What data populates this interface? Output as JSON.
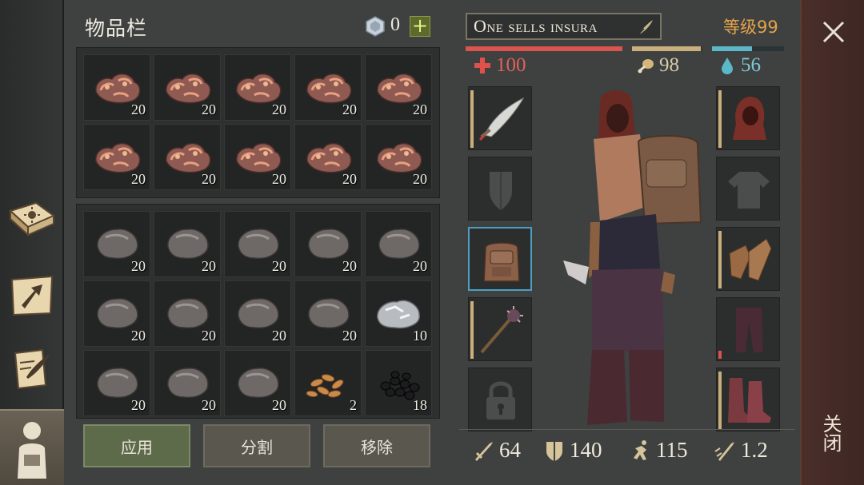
{
  "inventory": {
    "title": "物品栏",
    "currency_count": "0",
    "add_label": "+",
    "top_grid": [
      {
        "item": "copper-ore",
        "qty": "20"
      },
      {
        "item": "copper-ore",
        "qty": "20"
      },
      {
        "item": "copper-ore",
        "qty": "20"
      },
      {
        "item": "copper-ore",
        "qty": "20"
      },
      {
        "item": "copper-ore",
        "qty": "20"
      },
      {
        "item": "copper-ore",
        "qty": "20"
      },
      {
        "item": "copper-ore",
        "qty": "20"
      },
      {
        "item": "copper-ore",
        "qty": "20"
      },
      {
        "item": "copper-ore",
        "qty": "20"
      },
      {
        "item": "copper-ore",
        "qty": "20"
      }
    ],
    "bottom_grid": [
      {
        "item": "stone",
        "qty": "20"
      },
      {
        "item": "stone",
        "qty": "20"
      },
      {
        "item": "stone",
        "qty": "20"
      },
      {
        "item": "stone",
        "qty": "20"
      },
      {
        "item": "stone",
        "qty": "20"
      },
      {
        "item": "stone",
        "qty": "20"
      },
      {
        "item": "stone",
        "qty": "20"
      },
      {
        "item": "stone",
        "qty": "20"
      },
      {
        "item": "stone",
        "qty": "20"
      },
      {
        "item": "iron-ore",
        "qty": "10"
      },
      {
        "item": "stone",
        "qty": "20"
      },
      {
        "item": "stone",
        "qty": "20"
      },
      {
        "item": "stone",
        "qty": "20"
      },
      {
        "item": "seeds",
        "qty": "2"
      },
      {
        "item": "coal",
        "qty": "18"
      }
    ],
    "buttons": {
      "apply": "应用",
      "split": "分割",
      "remove": "移除"
    }
  },
  "character": {
    "name": "One sells insura",
    "level": "等级99",
    "health": {
      "value": "100",
      "fraction": 1.0,
      "color": "#d9534f"
    },
    "hunger": {
      "value": "98",
      "fraction": 0.98,
      "color": "#c9ae7e"
    },
    "thirst": {
      "value": "56",
      "fraction": 0.56,
      "color": "#5bb8c8"
    },
    "equipment_left": [
      {
        "slot": "weapon",
        "item": "scimitar-icon",
        "durability": 1.0
      },
      {
        "slot": "shield",
        "item": "shield-placeholder-icon",
        "durability": 0
      },
      {
        "slot": "backpack",
        "item": "backpack-icon",
        "durability": 0,
        "selected": true
      },
      {
        "slot": "offhand",
        "item": "mace-icon",
        "durability": 1.0
      },
      {
        "slot": "locked",
        "item": "lock-icon",
        "durability": 0
      }
    ],
    "equipment_right": [
      {
        "slot": "head",
        "item": "hood-icon",
        "durability": 1.0
      },
      {
        "slot": "chest",
        "item": "shirt-placeholder-icon",
        "durability": 0
      },
      {
        "slot": "hands",
        "item": "gloves-icon",
        "durability": 1.0
      },
      {
        "slot": "legs",
        "item": "pants-icon",
        "durability": 0.15
      },
      {
        "slot": "feet",
        "item": "boots-icon",
        "durability": 1.0
      }
    ],
    "stats": {
      "attack": "64",
      "defense": "140",
      "speed": "115",
      "attack_speed": "1.2"
    }
  },
  "close_label": "关闭"
}
